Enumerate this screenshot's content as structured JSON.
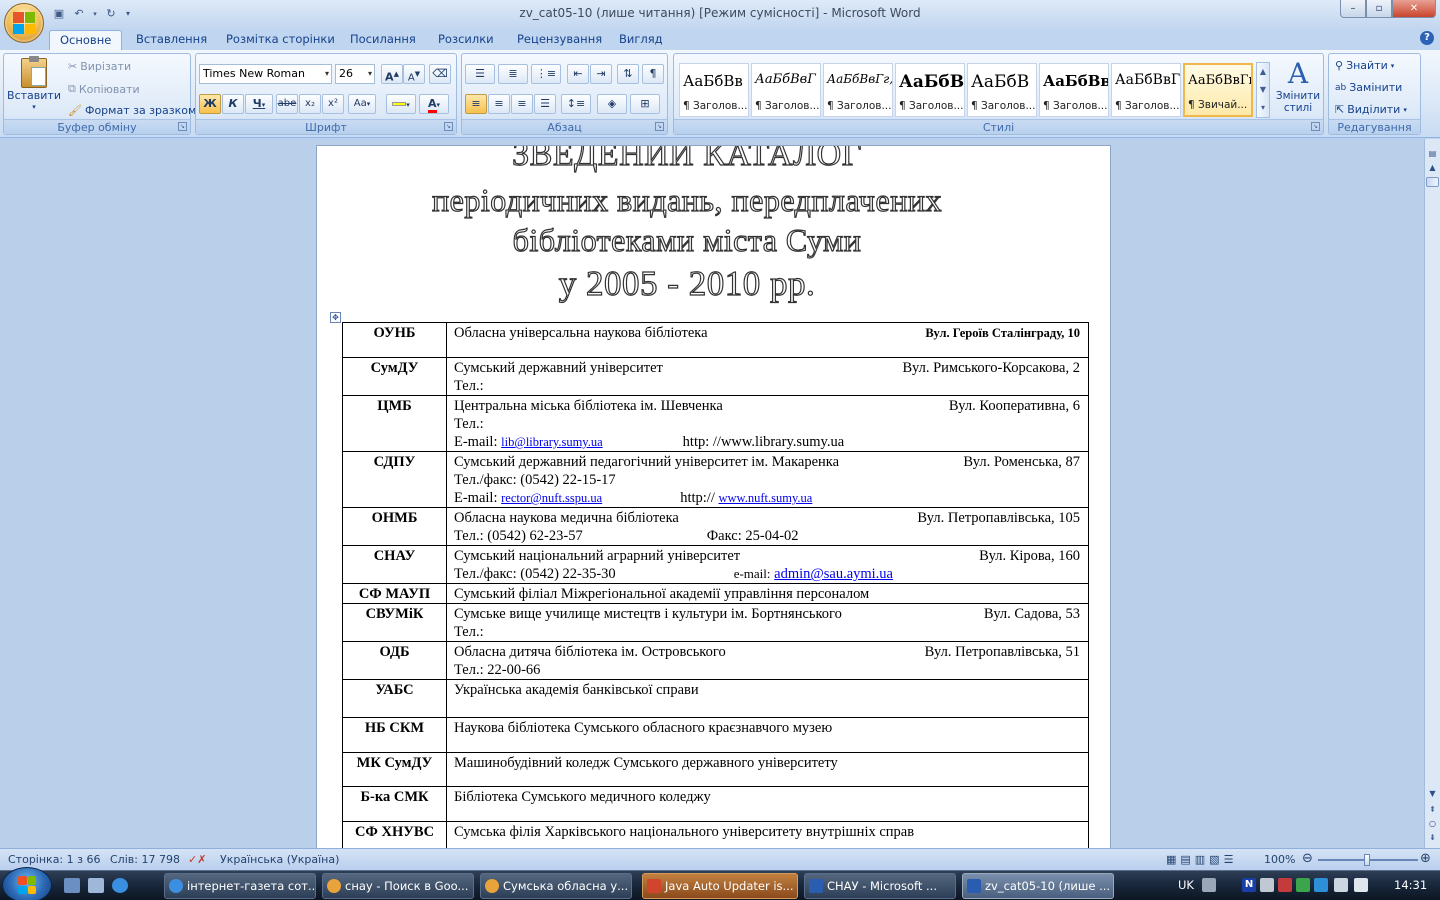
{
  "window": {
    "title": "zv_cat05-10 (лише читання) [Режим сумісності] - Microsoft Word",
    "controls": {
      "minimize": "–",
      "maximize": "▫",
      "close": "✕"
    }
  },
  "qat": {
    "save_icon": "save-icon",
    "undo_icon": "undo-icon",
    "redo_icon": "redo-icon"
  },
  "tabs": [
    {
      "label": "Основне",
      "active": true
    },
    {
      "label": "Вставлення"
    },
    {
      "label": "Розмітка сторінки"
    },
    {
      "label": "Посилання"
    },
    {
      "label": "Розсилки"
    },
    {
      "label": "Рецензування"
    },
    {
      "label": "Вигляд"
    }
  ],
  "ribbon": {
    "clipboard": {
      "label": "Буфер обміну",
      "paste": "Вставити",
      "cut": "Вирізати",
      "copy": "Копіювати",
      "format_painter": "Формат за зразком"
    },
    "font": {
      "label": "Шрифт",
      "family": "Times New Roman",
      "size": "26",
      "bold": "Ж",
      "italic": "К",
      "underline": "Ч",
      "strike": "abe",
      "subscript": "x₂",
      "superscript": "x²",
      "change_case": "Aa",
      "grow": "A",
      "shrink": "A",
      "highlight_color": "#ffff00",
      "font_color": "#ff0000"
    },
    "paragraph": {
      "label": "Абзац"
    },
    "styles": {
      "label": "Стилі",
      "items": [
        {
          "preview": "АаБбВв",
          "name": "¶ Заголов..."
        },
        {
          "preview": "АаБбВвГ",
          "name": "¶ Заголов..."
        },
        {
          "preview": "АаБбВвГг,",
          "name": "¶ Заголов..."
        },
        {
          "preview": "АаБбВ",
          "name": "¶ Заголов..."
        },
        {
          "preview": "АаБбВ",
          "name": "¶ Заголов..."
        },
        {
          "preview": "АаБбВв",
          "name": "¶ Заголов..."
        },
        {
          "preview": "АаБбВвГ",
          "name": "¶ Заголов..."
        },
        {
          "preview": "АаБбВвГг,",
          "name": "¶ Звичай..."
        }
      ],
      "change_styles": "Змінити стилі"
    },
    "editing": {
      "label": "Редагування",
      "find": "Знайти",
      "replace": "Замінити",
      "select": "Виділити"
    }
  },
  "document": {
    "title_lines": [
      "ЗВЕДЕНИЙ КАТАЛОГ",
      "періодичних видань, передплачених",
      "бібліотеками міста Суми",
      "у 2005 - 2010 рр."
    ],
    "rows": [
      {
        "abbr": "ОУНБ",
        "name": "Обласна універсальна наукова бібліотека",
        "addr": "Вул. Героїв Сталінграду, 10"
      },
      {
        "abbr": "СумДУ",
        "name": "Сумський державний університет",
        "addr": "Вул. Римського-Корсакова, 2",
        "tel": "Тел.:"
      },
      {
        "abbr": "ЦМБ",
        "name": "Центральна міська бібліотека ім. Шевченка",
        "addr": "Вул. Кооперативна, 6",
        "tel": "Тел.:",
        "email_label": "E-mail:",
        "email": "lib@library.sumy.ua",
        "web": "http: //www.library.sumy.ua"
      },
      {
        "abbr": "СДПУ",
        "name": "Сумський державний педагогічний університет ім. Макаренка",
        "addr": "Вул. Роменська, 87",
        "tel": "Тел./факс: (0542) 22-15-17",
        "email_label": "E-mail:",
        "email": "rector@nuft.sspu.ua",
        "web_label": "http://",
        "web": "www.nuft.sumy.ua"
      },
      {
        "abbr": "ОНМБ",
        "name": "Обласна  наукова медична бібліотека",
        "addr": "Вул. Петропавлівська, 105",
        "tel": "Тел.: (0542) 62-23-57",
        "fax": "Факс: 25-04-02"
      },
      {
        "abbr": "СНАУ",
        "name": "Сумський національний аграрний університет",
        "addr": "Вул. Кірова, 160",
        "tel": "Тел./факс: (0542) 22-35-30",
        "email_label": "e-mail:",
        "email": "admin@sau.aymi.ua"
      },
      {
        "abbr": "СФ МАУП",
        "name": "Сумський філіал Міжрегіональної академії управління персоналом"
      },
      {
        "abbr": "СВУМіК",
        "name": "Сумське вище училище мистецтв і культури ім. Бортнянського",
        "addr": "Вул. Садова, 53",
        "tel": "Тел.:"
      },
      {
        "abbr": "ОДБ",
        "name": "Обласна дитяча бібліотека ім. Островського",
        "addr": "Вул. Петропавлівська, 51",
        "tel": "Тел.: 22-00-66"
      },
      {
        "abbr": "УАБС",
        "name": "Українська академія банківської справи"
      },
      {
        "abbr": "НБ СКМ",
        "name": "Наукова бібліотека Сумського обласного краєзнавчого музею"
      },
      {
        "abbr": "МК СумДУ",
        "name": "Машинобудівний коледж Сумського державного університету"
      },
      {
        "abbr": "Б-ка СМК",
        "name": "Бібліотека Сумського медичного коледжу"
      },
      {
        "abbr": "СФ ХНУВС",
        "name": "Сумська філія  Харківського національного університету внутрішніх справ"
      }
    ]
  },
  "status": {
    "page": "Сторінка: 1 з 66",
    "words": "Слів: 17 798",
    "language": "Українська (Україна)",
    "zoom": "100%"
  },
  "taskbar": {
    "items": [
      {
        "label": "інтернет-газета сот...",
        "color": "#3b8fe0"
      },
      {
        "label": "снау - Поиск в Goo...",
        "color": "#e8a33a"
      },
      {
        "label": "Сумська обласна у...",
        "color": "#e8a33a"
      },
      {
        "label": "Java Auto Updater is...",
        "color": "#d2452d",
        "active": true
      },
      {
        "label": "СНАУ - Microsoft ...",
        "color": "#2a5db0"
      },
      {
        "label": "zv_cat05-10 (лише ...",
        "color": "#2a5db0"
      }
    ],
    "lang": "UK",
    "clock": "14:31"
  }
}
